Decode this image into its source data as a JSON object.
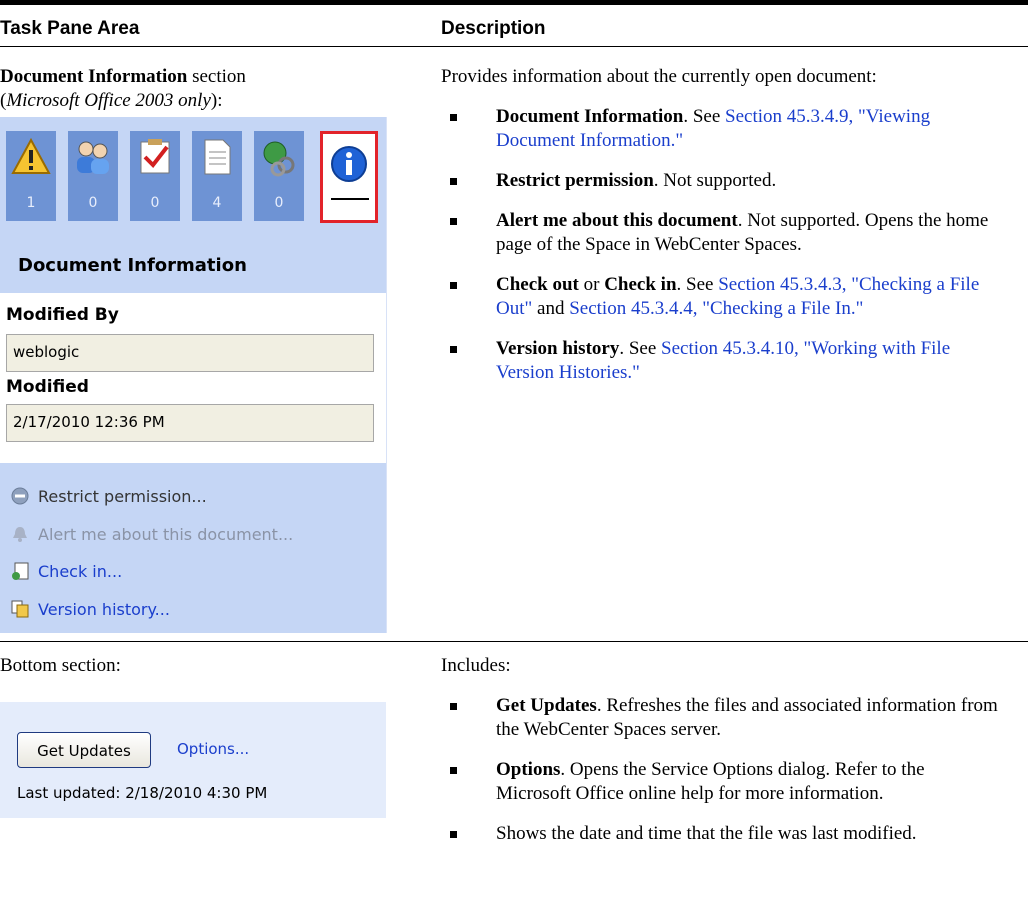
{
  "header": {
    "col1": "Task Pane Area",
    "col2": "Description"
  },
  "row1": {
    "left": {
      "title_bold": "Document Information",
      "title_rest": " section",
      "note_open": "(",
      "note_italic": "Microsoft Office 2003 only",
      "note_close": "):"
    },
    "pane": {
      "tabs": [
        {
          "icon": "warning-icon",
          "count": "1"
        },
        {
          "icon": "members-icon",
          "count": "0"
        },
        {
          "icon": "tasks-icon",
          "count": "0"
        },
        {
          "icon": "document-icon",
          "count": "4"
        },
        {
          "icon": "links-icon",
          "count": "0"
        }
      ],
      "active_tab_icon": "info-icon",
      "section_title": "Document Information",
      "modified_by_label": "Modified By",
      "modified_by_value": "weblogic",
      "modified_label": "Modified",
      "modified_value": "2/17/2010 12:36 PM",
      "actions": [
        "Restrict permission...",
        "Alert me about this document...",
        "Check in...",
        "Version history..."
      ],
      "colors": {
        "pane_bg": "#c5d6f5",
        "tab_bg": "#6e93d4",
        "active_border": "#e2232a",
        "link": "#1a3ecc"
      }
    },
    "right": {
      "intro": "Provides information about the currently open document:",
      "items": [
        {
          "bold": "Document Information",
          "text": ". See ",
          "link": "Section 45.3.4.9, \"Viewing Document Information.\""
        },
        {
          "bold": "Restrict permission",
          "text": ". Not supported."
        },
        {
          "bold": "Alert me about this document",
          "text": ". Not supported. Opens the home page of the Space in WebCenter Spaces."
        },
        {
          "bold": "Check out",
          "mid": " or ",
          "bold2": "Check in",
          "text": ". See ",
          "link": "Section 45.3.4.3, \"Checking a File Out\"",
          "and": " and ",
          "link2": "Section 45.3.4.4, \"Checking a File In.\""
        },
        {
          "bold": "Version history",
          "text": ". See ",
          "link": "Section 45.3.4.10, \"Working with File Version Histories.\""
        }
      ]
    }
  },
  "row2": {
    "left": {
      "label": "Bottom section:",
      "button": "Get Updates",
      "options_link": "Options...",
      "last_updated": "Last updated: 2/18/2010 4:30 PM"
    },
    "right": {
      "intro": "Includes:",
      "items": [
        {
          "bold": "Get Updates",
          "text": ". Refreshes the files and associated information from the WebCenter Spaces server."
        },
        {
          "bold": "Options",
          "text": ". Opens the Service Options dialog. Refer to the Microsoft Office online help for more information."
        },
        {
          "text": "Shows the date and time that the file was last modified."
        }
      ]
    }
  }
}
